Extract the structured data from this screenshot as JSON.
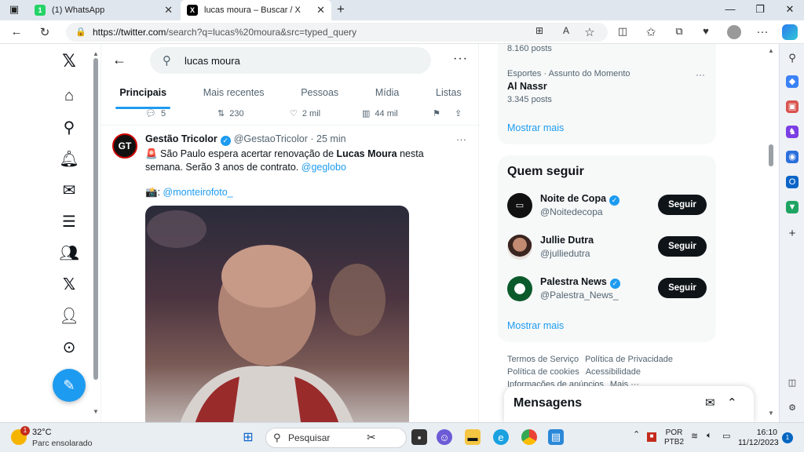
{
  "browser": {
    "tabs": [
      {
        "label": "(1) WhatsApp",
        "favicon": "1"
      },
      {
        "label": "lucas moura – Buscar / X",
        "favicon": "X"
      }
    ],
    "url_host": "https://twitter.com",
    "url_path": "/search?q=lucas%20moura&src=typed_query"
  },
  "search": {
    "query": "lucas moura"
  },
  "tabs": [
    "Principais",
    "Mais recentes",
    "Pessoas",
    "Mídia",
    "Listas"
  ],
  "prev_tweet_stats": {
    "replies": "5",
    "retweets": "230",
    "likes": "2 mil",
    "views": "44 mil"
  },
  "tweet": {
    "name": "Gestão Tricolor",
    "handle": "@GestaoTricolor",
    "time": "· 25 min",
    "avatar_text": "GT",
    "text_prefix": "🚨 São Paulo espera acertar renovação de ",
    "text_bold": "Lucas Moura",
    "text_suffix": " nesta semana. Serão 3 anos de contrato. ",
    "mention1": "@geglobo",
    "photo_credit_prefix": "📸: ",
    "mention2": "@monteirofoto_"
  },
  "trends": {
    "top_count": "8.160 posts",
    "trend": {
      "category": "Esportes · Assunto do Momento",
      "name": "Al Nassr",
      "count": "3.345 posts"
    },
    "show_more": "Mostrar mais"
  },
  "who_to_follow": {
    "title": "Quem seguir",
    "follow_label": "Seguir",
    "show_more": "Mostrar mais",
    "accounts": [
      {
        "name": "Noite de Copa",
        "handle": "@Noitedecopa",
        "verified": true,
        "color": "#111111"
      },
      {
        "name": "Jullie Dutra",
        "handle": "@julliedutra",
        "verified": false,
        "color": "#a0614f"
      },
      {
        "name": "Palestra News",
        "handle": "@Palestra_News_",
        "verified": true,
        "color": "#0b5a2b"
      }
    ]
  },
  "footer": {
    "links": [
      "Termos de Serviço",
      "Política de Privacidade",
      "Política de cookies",
      "Acessibilidade",
      "Informações de anúncios",
      "Mais ···"
    ]
  },
  "messages": {
    "title": "Mensagens"
  },
  "taskbar": {
    "temperature": "32°C",
    "weather": "Parc ensolarado",
    "weather_badge": "1",
    "search_placeholder": "Pesquisar",
    "lang": "POR",
    "layout": "PTB2",
    "time": "16:10",
    "date": "11/12/2023",
    "notif_count": "1"
  }
}
